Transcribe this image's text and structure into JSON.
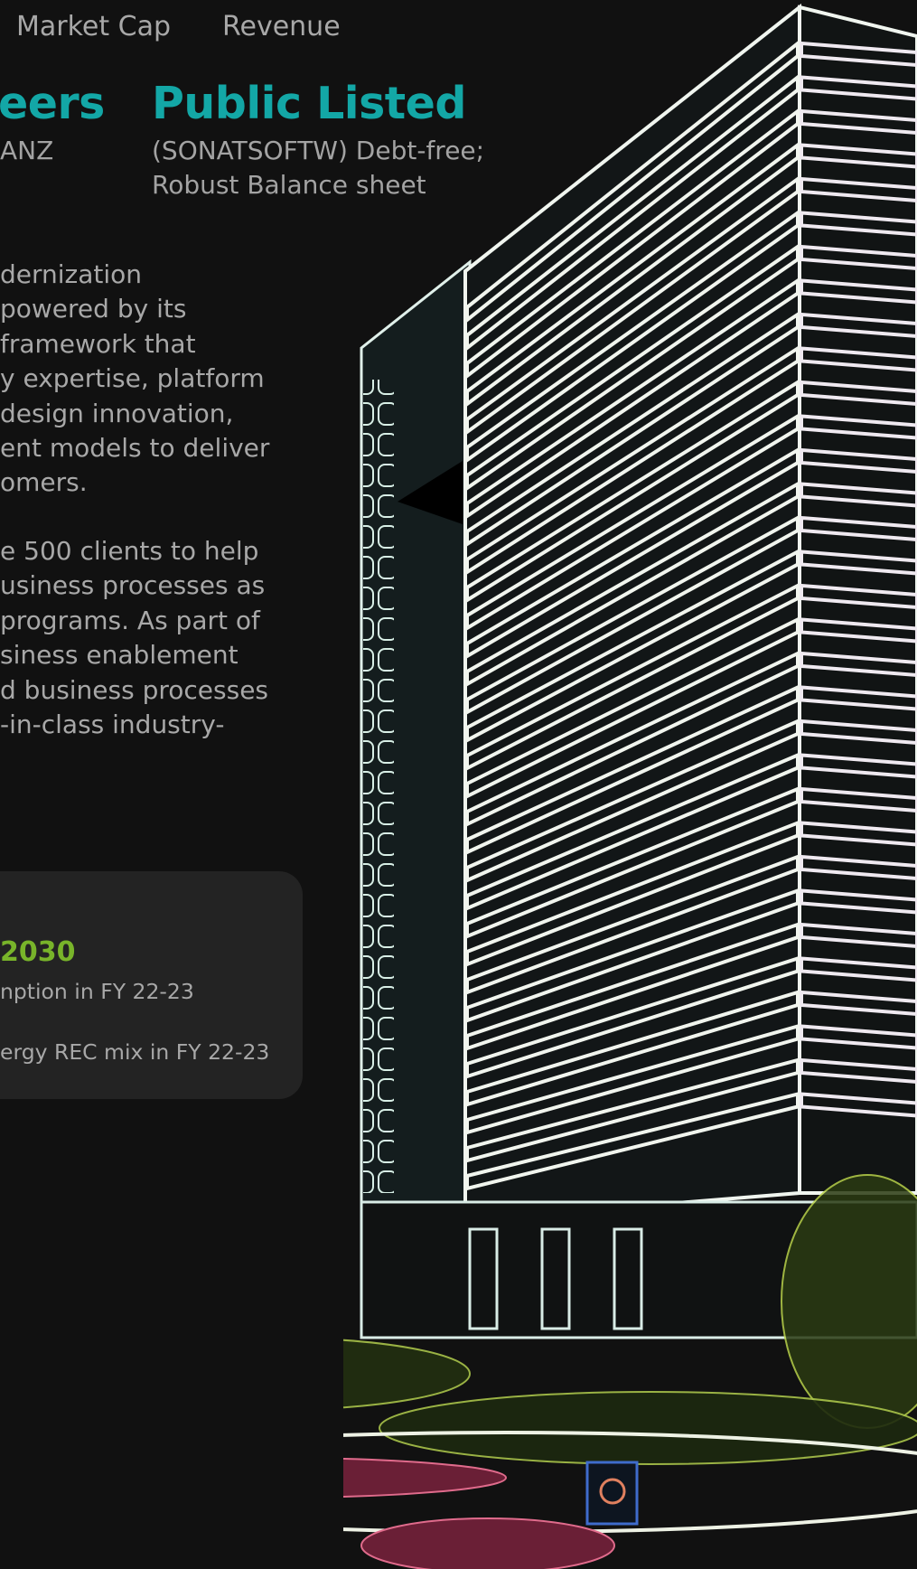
{
  "stats": {
    "market_cap_label": "Market Cap",
    "revenue_label": "Revenue"
  },
  "highlights": {
    "careers_fragment": "eers",
    "region_fragment": "ANZ",
    "public_title": "Public Listed",
    "public_desc_line1": "(SONATSOFTW) Debt-free;",
    "public_desc_line2": "Robust Balance sheet"
  },
  "body": {
    "para1": [
      "dernization",
      "powered by its",
      " framework that",
      "y expertise, platform",
      " design innovation,",
      "ent models to deliver",
      "omers."
    ],
    "para2": [
      "e 500 clients to help",
      "usiness processes as",
      "programs. As part of",
      "siness enablement",
      "d business processes",
      "-in-class industry-"
    ]
  },
  "esg": {
    "year": "2030",
    "line1": "nption in FY 22-23",
    "line2": "ergy REC mix in FY 22-23"
  },
  "colors": {
    "background": "#111111",
    "teal_accent": "#13a7a6",
    "green_accent": "#78b42a",
    "card_bg": "#232323"
  }
}
